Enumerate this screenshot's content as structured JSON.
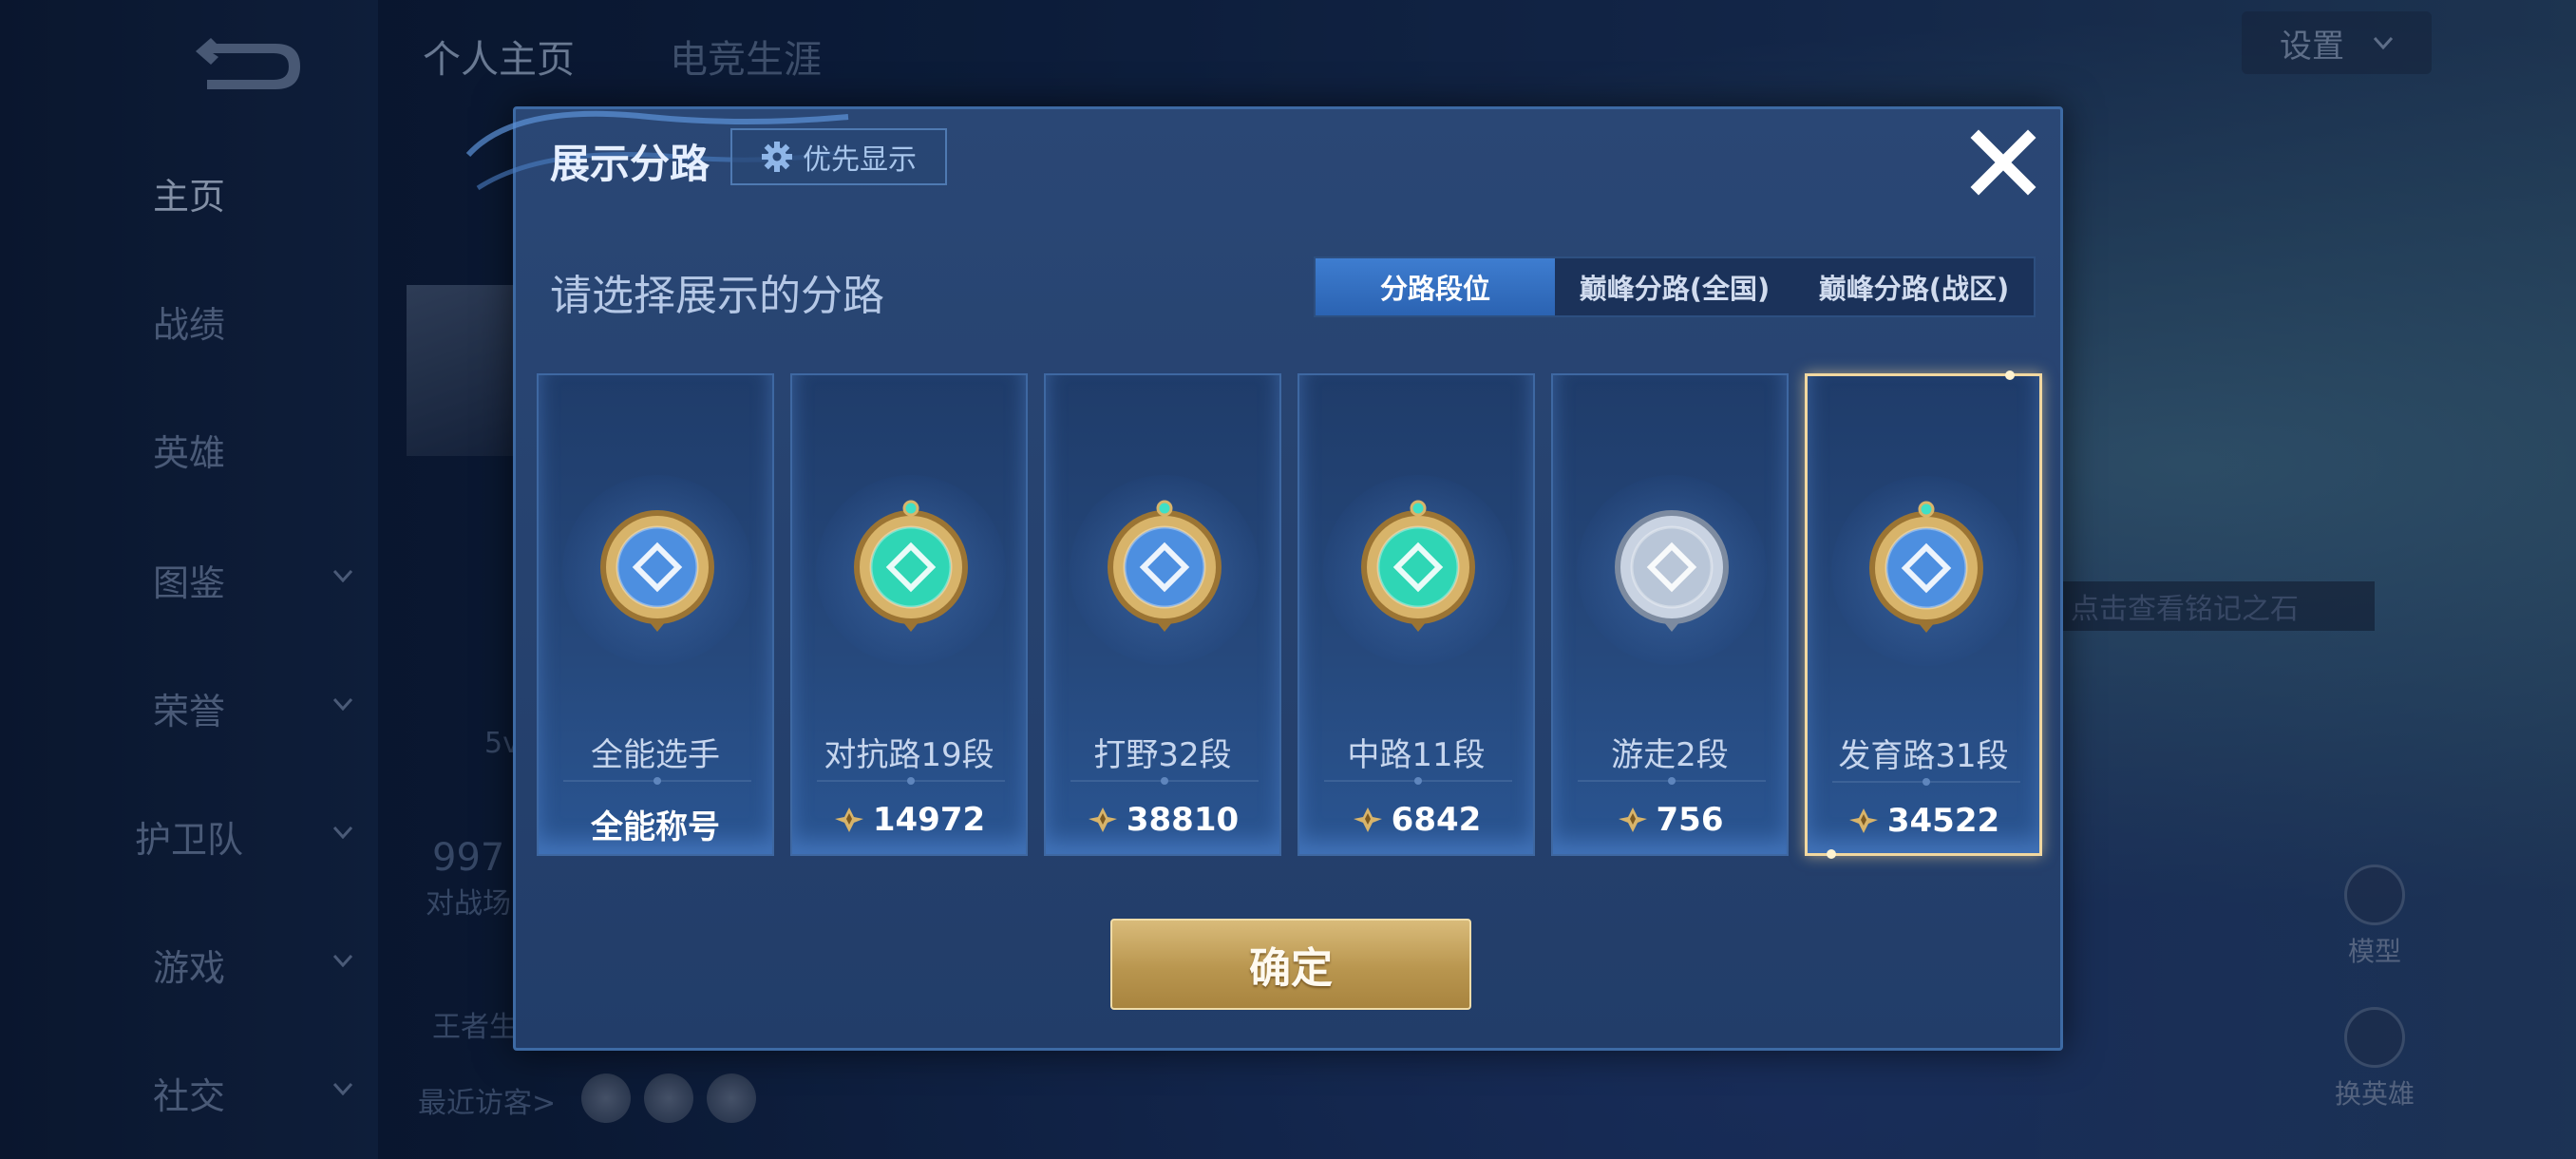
{
  "sidebar": {
    "items": [
      {
        "label": "主页",
        "active": true,
        "chevron": false
      },
      {
        "label": "战绩",
        "active": false,
        "chevron": false
      },
      {
        "label": "英雄",
        "active": false,
        "chevron": false
      },
      {
        "label": "图鉴",
        "active": false,
        "chevron": true
      },
      {
        "label": "荣誉",
        "active": false,
        "chevron": true
      },
      {
        "label": "护卫队",
        "active": false,
        "chevron": true
      },
      {
        "label": "游戏",
        "active": false,
        "chevron": true
      },
      {
        "label": "社交",
        "active": false,
        "chevron": true
      }
    ]
  },
  "page_tabs": [
    "个人主页",
    "电竞生涯"
  ],
  "settings_label": "设置",
  "background": {
    "stat_partial": "997",
    "stat_label_partial": "对战场",
    "mode_partial": "5v",
    "title_partial": "王者生",
    "recent_visitors_label": "最近访客>",
    "rune_hint": "点击查看铭记之石",
    "model_label": "模型",
    "switch_hero_label": "换英雄"
  },
  "modal": {
    "title": "展示分路",
    "priority_label": "优先显示",
    "subtitle": "请选择展示的分路",
    "tabs": [
      {
        "label": "分路段位",
        "active": true
      },
      {
        "label": "巅峰分路(全国)",
        "active": false
      },
      {
        "label": "巅峰分路(战区)",
        "active": false
      }
    ],
    "cards": [
      {
        "lane": "全能选手",
        "value": "全能称号",
        "has_points_icon": false,
        "emblem": "all-round-emblem-icon",
        "selected": false
      },
      {
        "lane": "对抗路19段",
        "value": "14972",
        "has_points_icon": true,
        "emblem": "clash-lane-emblem-icon",
        "selected": false
      },
      {
        "lane": "打野32段",
        "value": "38810",
        "has_points_icon": true,
        "emblem": "jungle-emblem-icon",
        "selected": false
      },
      {
        "lane": "中路11段",
        "value": "6842",
        "has_points_icon": true,
        "emblem": "mid-lane-emblem-icon",
        "selected": false
      },
      {
        "lane": "游走2段",
        "value": "756",
        "has_points_icon": true,
        "emblem": "roam-emblem-icon",
        "selected": false
      },
      {
        "lane": "发育路31段",
        "value": "34522",
        "has_points_icon": true,
        "emblem": "farm-lane-emblem-icon",
        "selected": true
      }
    ],
    "confirm_label": "确定"
  },
  "colors": {
    "accent_blue": "#3e7dd0",
    "gold": "#c9a862",
    "selected_border": "#f2d8a0"
  }
}
